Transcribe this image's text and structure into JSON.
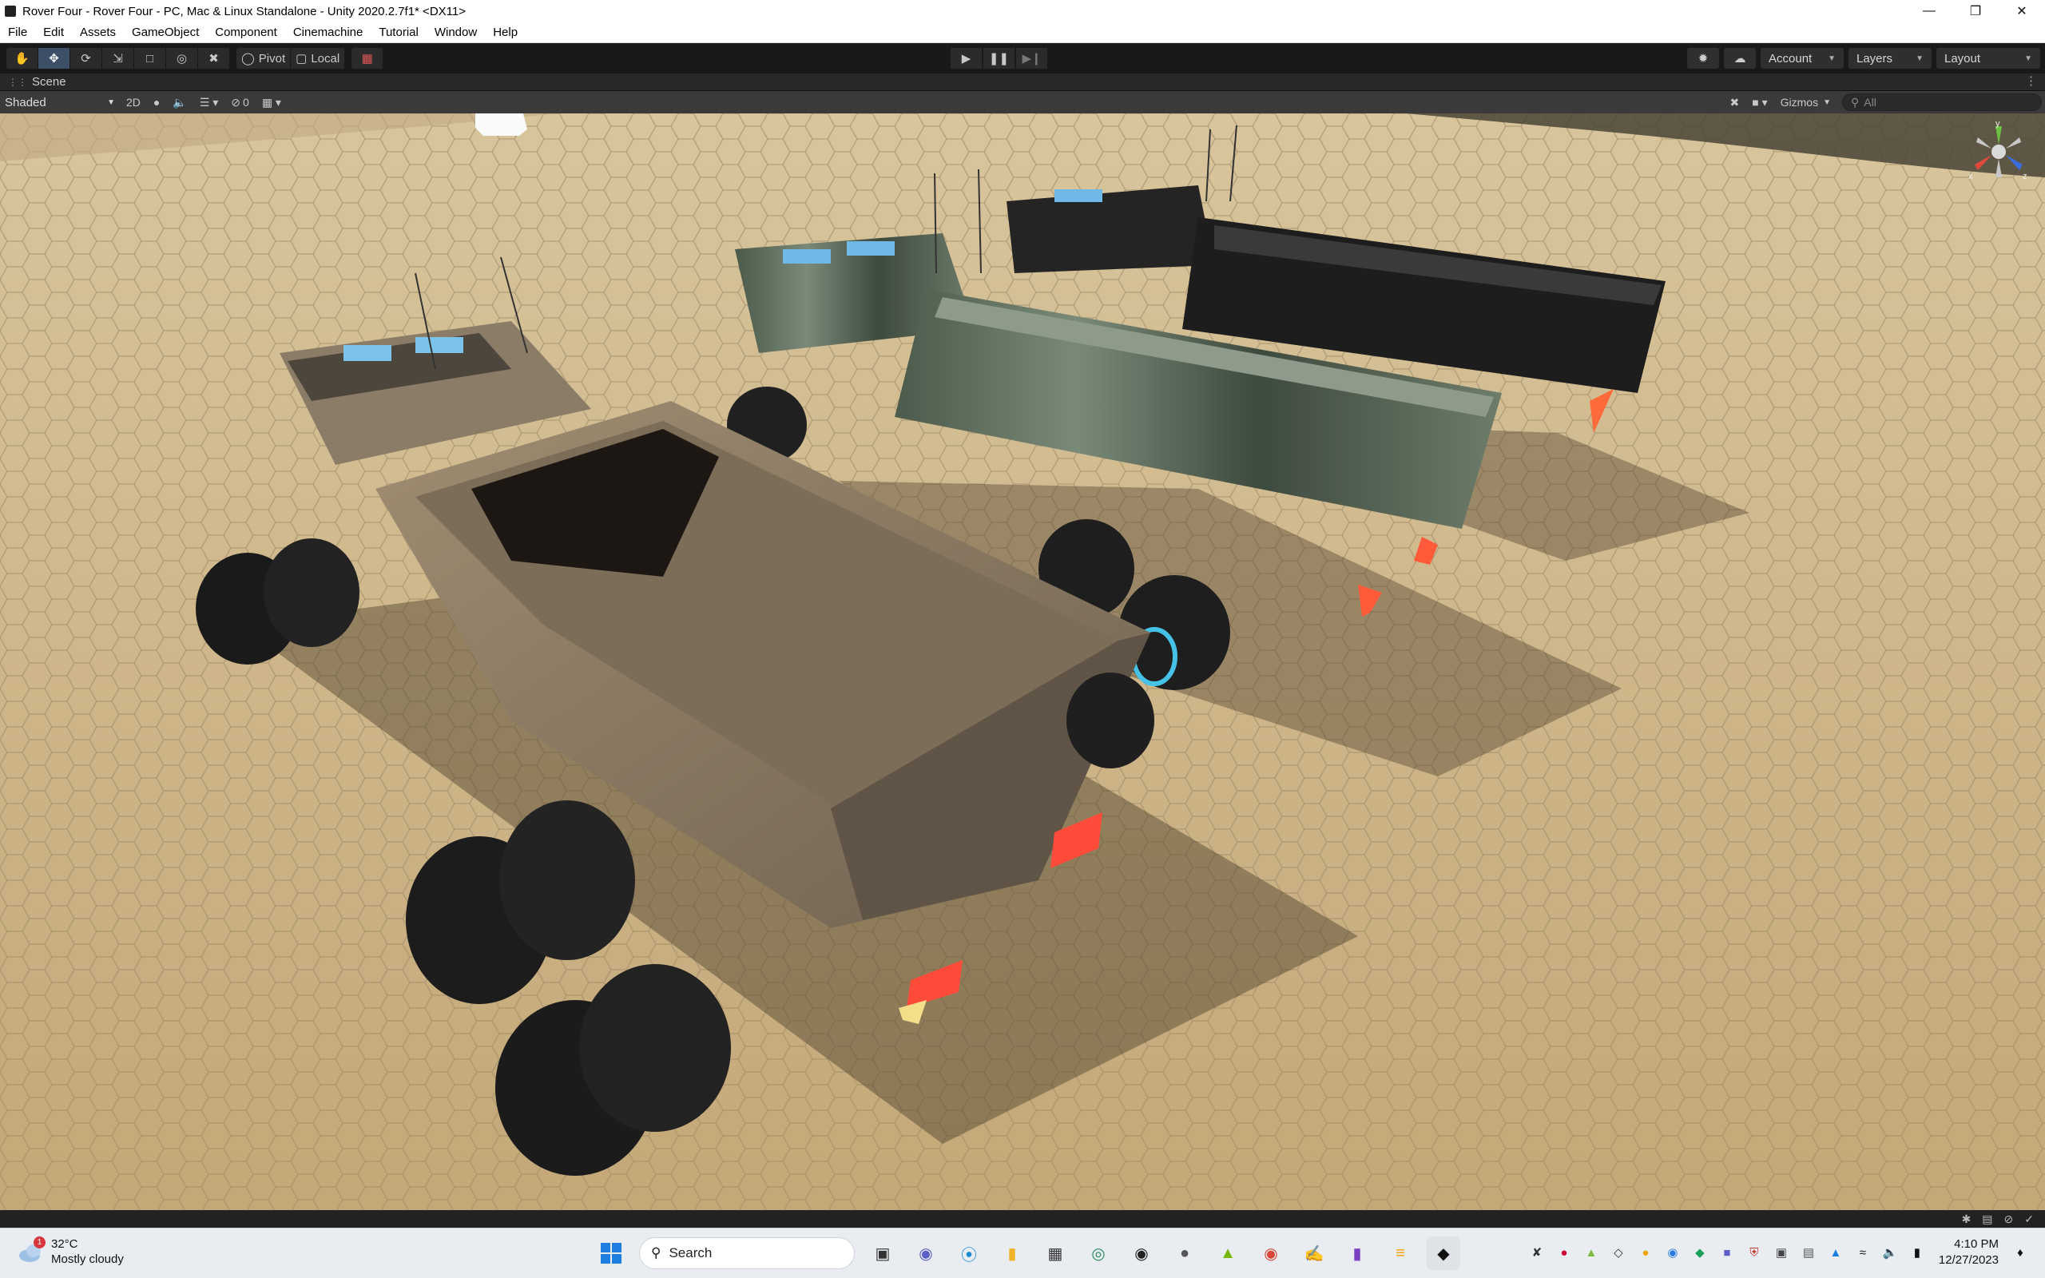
{
  "window": {
    "title": "Rover Four - Rover Four - PC, Mac & Linux Standalone - Unity 2020.2.7f1* <DX11>"
  },
  "menu": [
    "File",
    "Edit",
    "Assets",
    "GameObject",
    "Component",
    "Cinemachine",
    "Tutorial",
    "Window",
    "Help"
  ],
  "toolbar": {
    "pivot_label": "Pivot",
    "local_label": "Local",
    "account_label": "Account",
    "layers_label": "Layers",
    "layout_label": "Layout"
  },
  "scene": {
    "tab_label": "Scene",
    "shading_mode": "Shaded",
    "mode_2d": "2D",
    "hidden_count": "0",
    "gizmos_label": "Gizmos",
    "search_placeholder": "All",
    "gizmo_axes": {
      "x": "x",
      "y": "y",
      "z": "z"
    }
  },
  "taskbar": {
    "weather_temp": "32°C",
    "weather_desc": "Mostly cloudy",
    "weather_badge": "1",
    "search_label": "Search",
    "time": "4:10 PM",
    "date": "12/27/2023"
  },
  "colors": {
    "accent": "#3d4f66",
    "ground": "#cdb488",
    "taillight": "#ff4b3a"
  }
}
